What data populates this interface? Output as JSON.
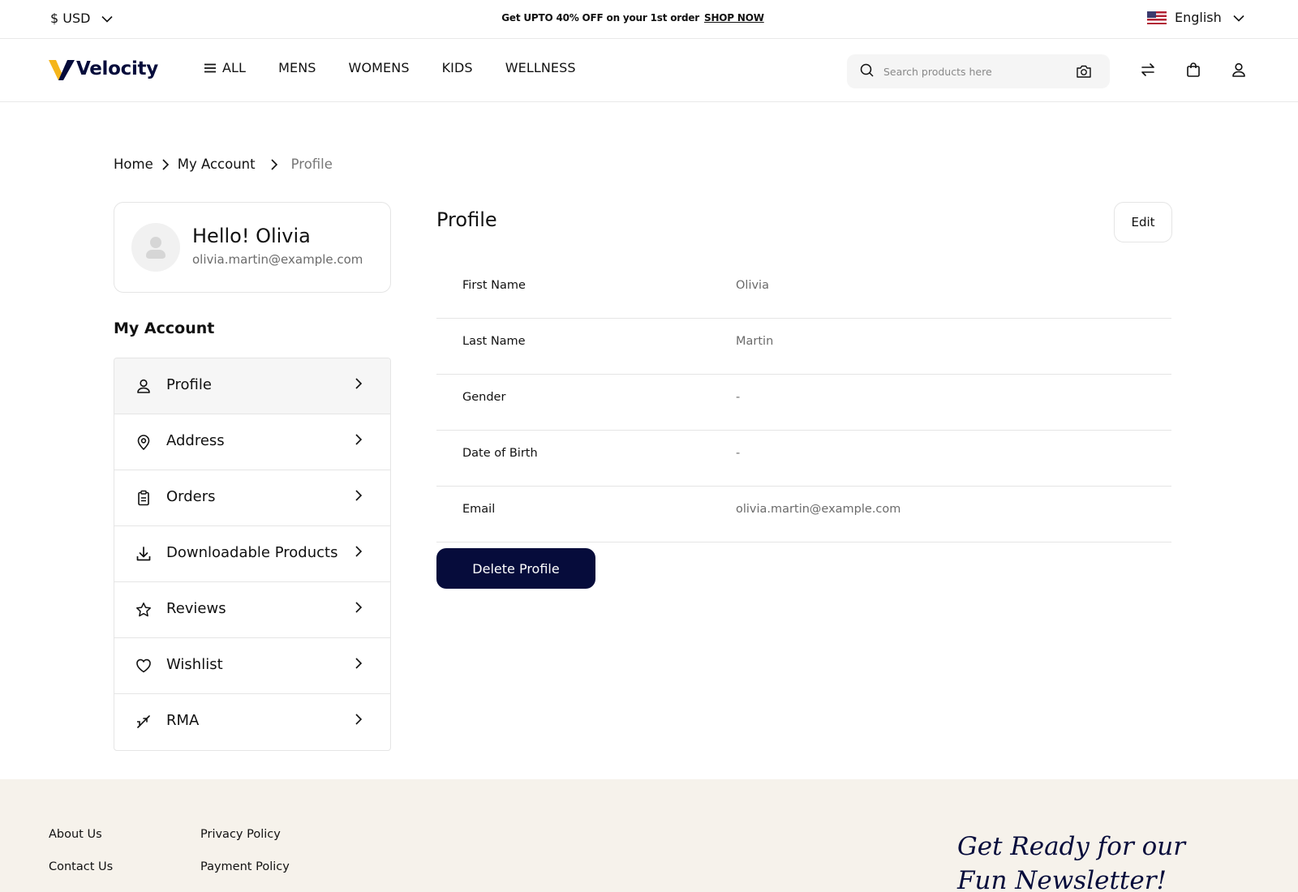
{
  "topbar": {
    "currency": "$ USD",
    "promo_text": "Get UPTO 40% OFF on your 1st order",
    "promo_link": "SHOP NOW",
    "language": "English"
  },
  "header": {
    "logo_text": "Velocity",
    "nav": [
      {
        "label": "ALL"
      },
      {
        "label": "MENS"
      },
      {
        "label": "WOMENS"
      },
      {
        "label": "KIDS"
      },
      {
        "label": "WELLNESS"
      }
    ],
    "search_placeholder": "Search products here"
  },
  "breadcrumb": {
    "home": "Home",
    "account": "My Account",
    "current": "Profile"
  },
  "user": {
    "greeting": "Hello! Olivia",
    "email": "olivia.martin@example.com"
  },
  "account_menu": {
    "title": "My Account",
    "items": [
      {
        "label": "Profile",
        "icon": "user-icon"
      },
      {
        "label": "Address",
        "icon": "location-pin-icon"
      },
      {
        "label": "Orders",
        "icon": "clipboard-icon"
      },
      {
        "label": "Downloadable Products",
        "icon": "download-icon"
      },
      {
        "label": "Reviews",
        "icon": "star-icon"
      },
      {
        "label": "Wishlist",
        "icon": "heart-icon"
      },
      {
        "label": "RMA",
        "icon": "return-arrows-icon"
      }
    ]
  },
  "profile": {
    "title": "Profile",
    "edit_label": "Edit",
    "fields": [
      {
        "label": "First Name",
        "value": "Olivia"
      },
      {
        "label": "Last Name",
        "value": "Martin"
      },
      {
        "label": "Gender",
        "value": "-"
      },
      {
        "label": "Date of Birth",
        "value": "-"
      },
      {
        "label": "Email",
        "value": "olivia.martin@example.com"
      }
    ],
    "delete_label": "Delete Profile"
  },
  "footer": {
    "col1": [
      "About Us",
      "Contact Us"
    ],
    "col2": [
      "Privacy Policy",
      "Payment Policy"
    ],
    "newsletter_line1": "Get Ready for our",
    "newsletter_line2": "Fun Newsletter!"
  },
  "colors": {
    "brand_navy": "#060c3b",
    "brand_yellow": "#f5b51b",
    "footer_bg": "#f6f2eb"
  }
}
